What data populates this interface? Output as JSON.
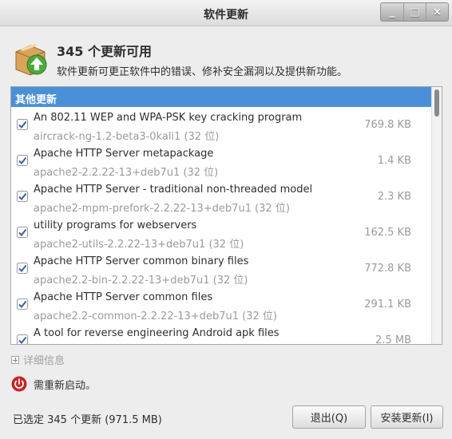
{
  "window": {
    "title": "软件更新",
    "buttons": {
      "minimize": "_",
      "maximize": "□",
      "close": "×"
    }
  },
  "header": {
    "title": "345 个更新可用",
    "description": "软件更新可更正软件中的错误、修补安全漏洞以及提供新功能。",
    "icon": "package-update-icon"
  },
  "list": {
    "group_title": "其他更新",
    "items": [
      {
        "name": "An 802.11 WEP and WPA-PSK key cracking program",
        "version": "aircrack-ng-1.2-beta3-0kali1 (32 位)",
        "size": "769.8 KB",
        "checked": true
      },
      {
        "name": "Apache HTTP Server metapackage",
        "version": "apache2-2.2.22-13+deb7u1 (32 位)",
        "size": "1.4 KB",
        "checked": true
      },
      {
        "name": "Apache HTTP Server - traditional non-threaded model",
        "version": "apache2-mpm-prefork-2.2.22-13+deb7u1 (32 位)",
        "size": "2.3 KB",
        "checked": true
      },
      {
        "name": "utility programs for webservers",
        "version": "apache2-utils-2.2.22-13+deb7u1 (32 位)",
        "size": "162.5 KB",
        "checked": true
      },
      {
        "name": "Apache HTTP Server common binary files",
        "version": "apache2.2-bin-2.2.22-13+deb7u1 (32 位)",
        "size": "772.8 KB",
        "checked": true
      },
      {
        "name": "Apache HTTP Server common files",
        "version": "apache2.2-common-2.2.22-13+deb7u1 (32 位)",
        "size": "291.1 KB",
        "checked": true
      },
      {
        "name": "A tool for reverse engineering Android apk files",
        "version": "",
        "size": "2.5 MB",
        "checked": true
      }
    ]
  },
  "details_label": "详细信息",
  "restart_notice": "需重新启动。",
  "footer": {
    "status": "已选定 345 个更新 (971.5 MB)",
    "quit_label": "退出(Q)",
    "install_label": "安装更新(I)"
  },
  "colors": {
    "accent": "#4a90d9",
    "restart_red": "#cc2222"
  }
}
